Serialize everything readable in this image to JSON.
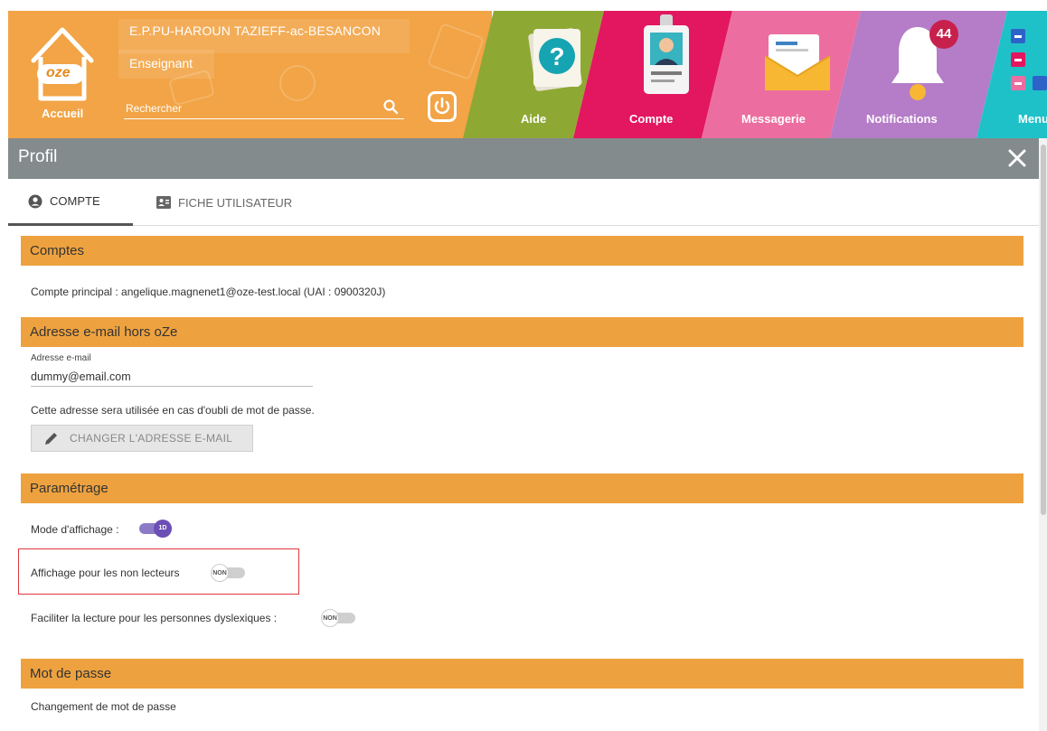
{
  "header": {
    "school": "E.P.PU-HAROUN TAZIEFF-ac-BESANCON",
    "role": "Enseignant",
    "home_label": "Accueil",
    "logo_text": "oze",
    "search_placeholder": "Rechercher",
    "tiles": {
      "aide": "Aide",
      "compte": "Compte",
      "messagerie": "Messagerie",
      "notifications": "Notifications",
      "menu": "Menu"
    },
    "notification_count": "44",
    "colors": {
      "orange": "#f2a446",
      "aide": "#8ea834",
      "compte": "#e2175f",
      "messagerie": "#ec6ea0",
      "notifications": "#b57cc8",
      "menu": "#1fc1c9"
    }
  },
  "profil": {
    "title": "Profil",
    "tabs": [
      "COMPTE",
      "FICHE UTILISATEUR"
    ]
  },
  "sections": {
    "comptes": {
      "title": "Comptes",
      "main_account": "Compte principal : angelique.magnenet1@oze-test.local (UAI : 0900320J)"
    },
    "email": {
      "title": "Adresse e-mail hors oZe",
      "field_label": "Adresse e-mail",
      "field_value": "dummy@email.com",
      "note": "Cette adresse sera utilisée en cas d'oubli de mot de passe.",
      "button": "CHANGER L'ADRESSE E-MAIL"
    },
    "parametrage": {
      "title": "Paramétrage",
      "mode_label": "Mode d'affichage :",
      "mode_value": "1D",
      "non_lecteurs_label": "Affichage pour les non lecteurs",
      "non_lecteurs_value": "NON",
      "dyslexie_label": "Faciliter la lecture pour les personnes dyslexiques :",
      "dyslexie_value": "NON"
    },
    "password": {
      "title": "Mot de passe",
      "change_label": "Changement de mot de passe"
    }
  },
  "accent_colors": {
    "section_header": "#eea23f",
    "toggle_on": "#6b4fb5",
    "highlight_border": "#e0393e"
  }
}
